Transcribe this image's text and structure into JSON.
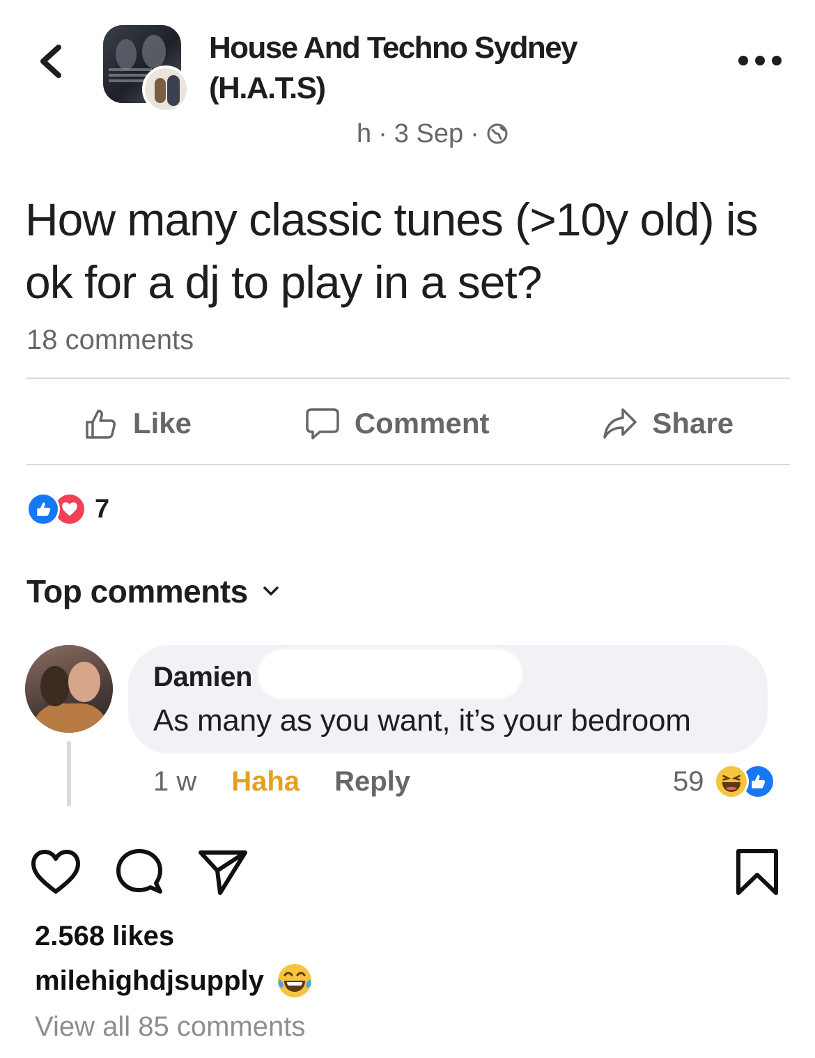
{
  "post": {
    "group_name": "House And Techno Sydney (H.A.T.S)",
    "meta": {
      "time": "h",
      "separator": "·",
      "date": "3 Sep",
      "separator2": "·",
      "audience_icon": "globe-icon"
    },
    "text": "How many classic tunes (>10y old) is ok for a dj to play in a set?",
    "comment_count": "18 comments",
    "actions": {
      "like": "Like",
      "comment": "Comment",
      "share": "Share"
    },
    "reactions": {
      "types": [
        "like",
        "love"
      ],
      "count": "7"
    },
    "top_comments_label": "Top comments"
  },
  "comment": {
    "author": "Damien",
    "text": "As many as you want, it’s your bedroom",
    "time": "1 w",
    "reaction_label": "Haha",
    "reply_label": "Reply",
    "reaction_count": "59",
    "reaction_types": [
      "haha",
      "like"
    ]
  },
  "instagram": {
    "likes": "2.568 likes",
    "username": "milehighdjsupply",
    "caption_emoji": "tears-of-joy-emoji",
    "view_all": "View all 85 comments"
  },
  "colors": {
    "text_primary": "#1c1e21",
    "text_secondary": "#65676b",
    "facebook_blue": "#1877f2",
    "love_red": "#f33e58",
    "haha_yellow": "#e5a11e",
    "bubble_bg": "#f0f2f5",
    "divider": "#d8dadf",
    "ig_muted": "#8e8e8e"
  }
}
